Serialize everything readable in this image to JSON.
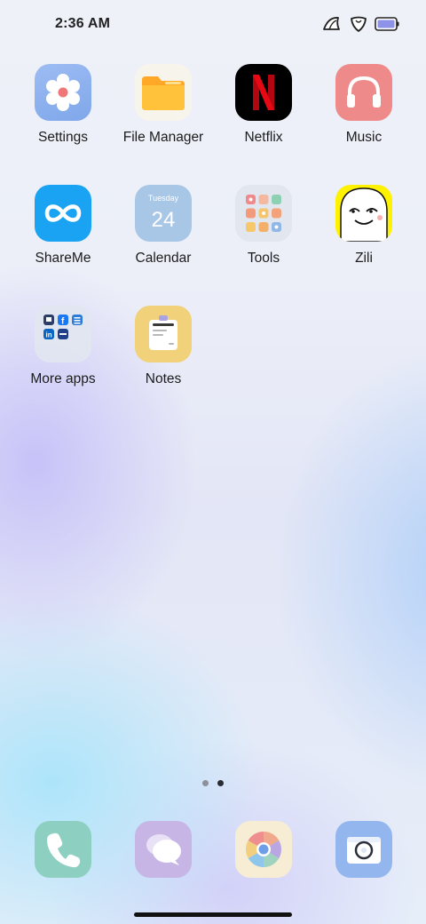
{
  "status_bar": {
    "time": "2:36 AM",
    "icons": [
      "notification-icon-1",
      "notification-icon-2",
      "battery-icon"
    ]
  },
  "apps": [
    {
      "label": "Settings",
      "icon": "settings-icon",
      "color": "#8fb3ef"
    },
    {
      "label": "File Manager",
      "icon": "folder-icon",
      "color": "#ffb62e"
    },
    {
      "label": "Netflix",
      "icon": "netflix-icon",
      "color": "#e50914"
    },
    {
      "label": "Music",
      "icon": "headphones-icon",
      "color": "#ef8a8a"
    },
    {
      "label": "ShareMe",
      "icon": "infinity-icon",
      "color": "#1ba1f2"
    },
    {
      "label": "Calendar",
      "icon": "calendar-icon",
      "color": "#a9c7e6"
    },
    {
      "label": "Tools",
      "icon": "folder-grid-icon",
      "color": "#e4e7ef"
    },
    {
      "label": "Zili",
      "icon": "zili-face-icon",
      "color": "#fff200"
    },
    {
      "label": "More apps",
      "icon": "folder-grid-icon",
      "color": "#e2e6f0"
    },
    {
      "label": "Notes",
      "icon": "notes-icon",
      "color": "#f2d37a"
    }
  ],
  "calendar": {
    "weekday": "Tuesday",
    "day": "24"
  },
  "page_indicator": {
    "count": 2,
    "active": 2
  },
  "dock": [
    {
      "name": "phone",
      "icon": "phone-icon",
      "color": "#8ccfc0"
    },
    {
      "name": "messages",
      "icon": "chat-icon",
      "color": "#c7b6e6"
    },
    {
      "name": "browser",
      "icon": "browser-icon",
      "color": "#f6ecd6"
    },
    {
      "name": "camera",
      "icon": "camera-icon",
      "color": "#93b7ef"
    }
  ]
}
